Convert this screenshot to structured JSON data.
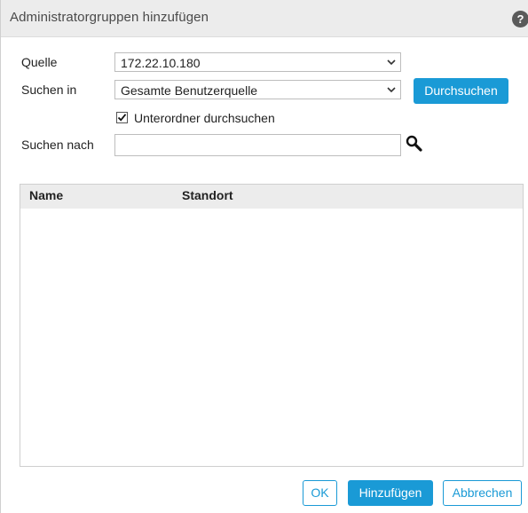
{
  "dialog": {
    "title": "Administratorgruppen hinzufügen",
    "help_label": "?"
  },
  "form": {
    "source_label": "Quelle",
    "source_value": "172.22.10.180",
    "search_in_label": "Suchen in",
    "search_in_value": "Gesamte Benutzerquelle",
    "browse_button": "Durchsuchen",
    "subfolders_label": "Unterordner durchsuchen",
    "subfolders_checked": true,
    "search_for_label": "Suchen nach",
    "search_for_value": "",
    "search_for_placeholder": ""
  },
  "table": {
    "columns": [
      "Name",
      "Standort"
    ],
    "rows": []
  },
  "footer": {
    "ok_label": "OK",
    "add_label": "Hinzufügen",
    "cancel_label": "Abbrechen"
  },
  "colors": {
    "accent": "#1a9ad6",
    "header_bg": "#ececec"
  },
  "icons": {
    "help": "help-icon",
    "chevron": "chevron-down-icon",
    "search": "magnifier-icon",
    "check": "checkmark-icon"
  }
}
